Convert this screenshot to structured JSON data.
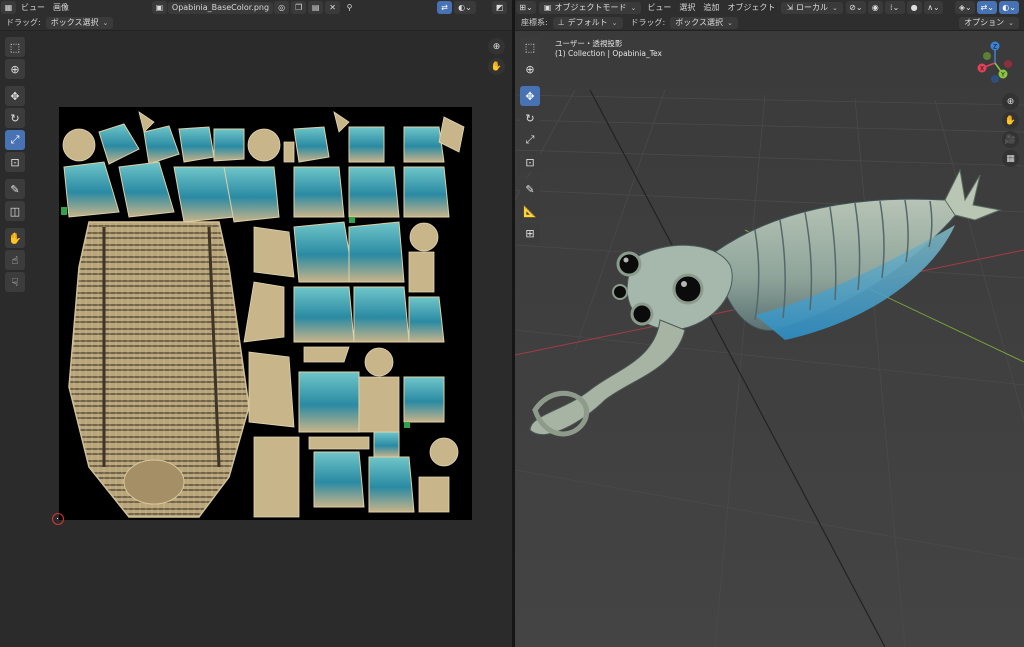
{
  "uv_editor": {
    "header": {
      "menu_view": "ビュー",
      "menu_image": "画像",
      "image_name": "Opabinia_BaseColor.png"
    },
    "tool_header": {
      "drag_label": "ドラッグ:",
      "drag_value": "ボックス選択"
    }
  },
  "viewport": {
    "header": {
      "mode": "オブジェクトモード",
      "menu_view": "ビュー",
      "menu_select": "選択",
      "menu_add": "追加",
      "menu_object": "オブジェクト",
      "transform_orientation": "ローカル"
    },
    "tool_header": {
      "orientation_label": "座標系:",
      "orientation_value": "デフォルト",
      "drag_label": "ドラッグ:",
      "drag_value": "ボックス選択",
      "options": "オプション"
    },
    "overlay": {
      "view_name": "ユーザー・透視投影",
      "collection_info": "(1) Collection | Opabinia_Tex"
    },
    "gizmo": {
      "x": "X",
      "y": "Y",
      "z": "Z"
    }
  },
  "colors": {
    "accent": "#4772b3",
    "axis_x": "#e2425a",
    "axis_y": "#8bc541",
    "axis_z": "#3a83d6"
  }
}
